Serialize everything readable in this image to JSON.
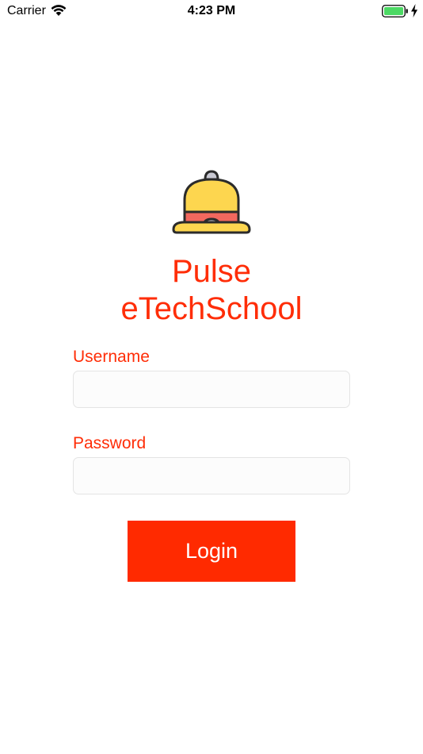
{
  "status_bar": {
    "carrier": "Carrier",
    "time": "4:23 PM",
    "icons": [
      "wifi-icon",
      "battery-icon",
      "charging-bolt-icon"
    ]
  },
  "app": {
    "logo_icon": "bell-icon",
    "title_line1": "Pulse",
    "title_line2": "eTechSchool"
  },
  "form": {
    "username_label": "Username",
    "username_value": "",
    "password_label": "Password",
    "password_value": "",
    "login_label": "Login"
  },
  "colors": {
    "accent": "#ff2d07",
    "button": "#ff2a00",
    "bell_yellow": "#fdd64f",
    "bell_band": "#f2685e",
    "battery_green": "#4cd964"
  }
}
